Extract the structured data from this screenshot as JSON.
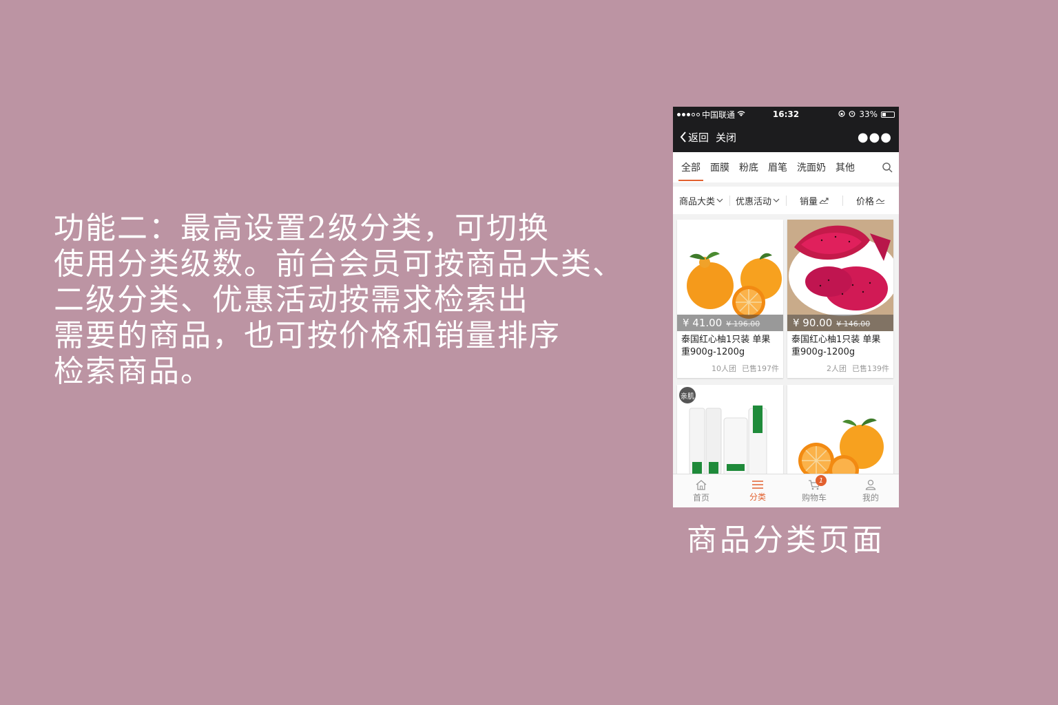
{
  "description_lines": [
    "功能二：最高设置2级分类，可切换",
    "使用分类级数。前台会员可按商品大类、",
    "二级分类、优惠活动按需求检索出",
    "需要的商品，也可按价格和销量排序",
    "检索商品。"
  ],
  "caption": "商品分类页面",
  "phone": {
    "status": {
      "carrier": "中国联通",
      "time": "16:32",
      "battery": "33%"
    },
    "nav": {
      "back": "返回",
      "close": "关闭"
    },
    "tabs": [
      "全部",
      "面膜",
      "粉底",
      "眉笔",
      "洗面奶",
      "其他"
    ],
    "active_tab": "全部",
    "filters": [
      {
        "label": "商品大类"
      },
      {
        "label": "优惠活动"
      },
      {
        "label": "销量"
      },
      {
        "label": "价格"
      }
    ],
    "products": [
      {
        "price": "¥ 41.00",
        "old_price": "¥ 196.00",
        "title": "泰国红心柚1只装 单果重900g-1200g",
        "group": "10人团",
        "sold": "已售197件"
      },
      {
        "price": "¥ 90.00",
        "old_price": "¥ 146.00",
        "title": "泰国红心柚1只装 单果重900g-1200g",
        "group": "2人团",
        "sold": "已售139件"
      },
      {
        "badge": "亲肌"
      },
      {}
    ],
    "tabbar": [
      {
        "label": "首页"
      },
      {
        "label": "分类",
        "active": true
      },
      {
        "label": "购物车",
        "badge": "1"
      },
      {
        "label": "我的"
      }
    ],
    "colors": {
      "accent": "#e2602e",
      "dark_bar": "#1c1c1e",
      "background": "#bc94a3"
    }
  }
}
